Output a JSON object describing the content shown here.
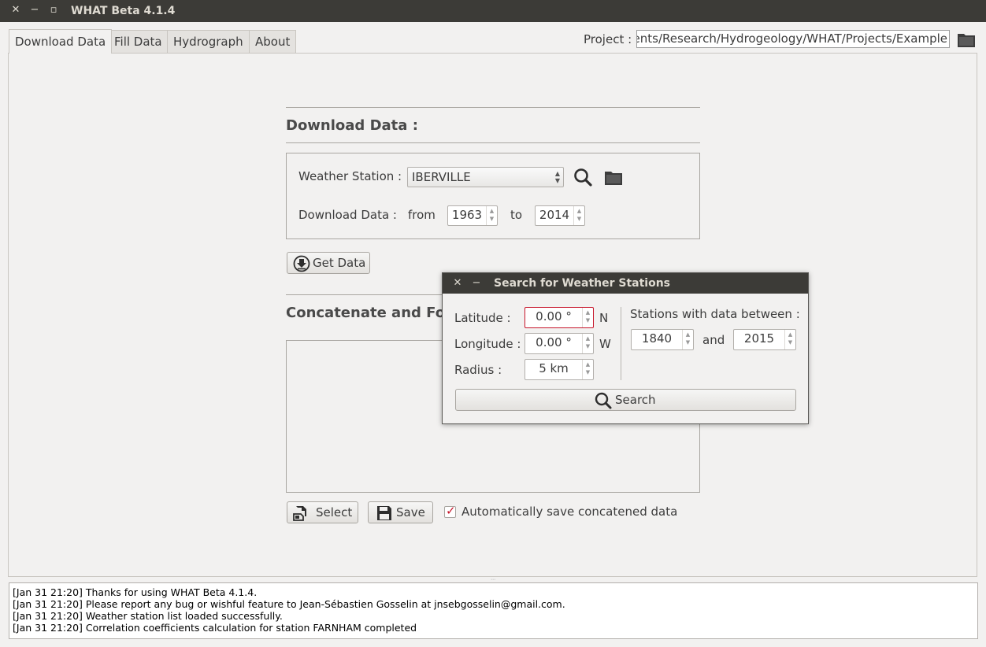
{
  "window": {
    "title": "WHAT Beta 4.1.4",
    "close_glyph": "✕",
    "minimize_glyph": "−",
    "maximize_glyph": "▫"
  },
  "tabs": [
    {
      "label": "Download Data",
      "active": true
    },
    {
      "label": "Fill Data",
      "active": false
    },
    {
      "label": "Hydrograph",
      "active": false
    },
    {
      "label": "About",
      "active": false
    }
  ],
  "project": {
    "label": "Project :",
    "path": "ents/Research/Hydrogeology/WHAT/Projects/Example"
  },
  "download_section": {
    "title": "Download Data :",
    "station_label": "Weather Station :",
    "station_value": "IBERVILLE",
    "download_label": "Download Data :",
    "from_label": "from",
    "from_value": "1963",
    "to_label": "to",
    "to_value": "2014",
    "get_data_label": "Get Data"
  },
  "concatenate_section": {
    "title": "Concatenate and Fo",
    "select_label": "Select",
    "save_label": "Save",
    "auto_save_label": "Automatically save concatened data",
    "auto_save_checked": true
  },
  "dialog": {
    "title": "Search for Weather Stations",
    "latitude_label": "Latitude :",
    "latitude_value": "0.00 °",
    "latitude_unit": "N",
    "longitude_label": "Longitude :",
    "longitude_value": "0.00 °",
    "longitude_unit": "W",
    "radius_label": "Radius :",
    "radius_value": "5 km",
    "stations_label": "Stations with data between :",
    "year_from": "1840",
    "and_label": "and",
    "year_to": "2015",
    "search_label": "Search"
  },
  "console": {
    "lines": [
      "[Jan 31 21:20] Thanks for using WHAT Beta 4.1.4.",
      "[Jan 31 21:20] Please report any bug or wishful feature to Jean-Sébastien Gosselin at jnsebgosselin@gmail.com.",
      "[Jan 31 21:20] Weather station list loaded successfully.",
      "[Jan 31 21:20] Correlation coefficients calculation for station FARNHAM completed"
    ]
  },
  "colors": {
    "titlebar": "#3c3b37",
    "window_bg": "#f2f1f0",
    "accent_red": "#c7162b"
  }
}
